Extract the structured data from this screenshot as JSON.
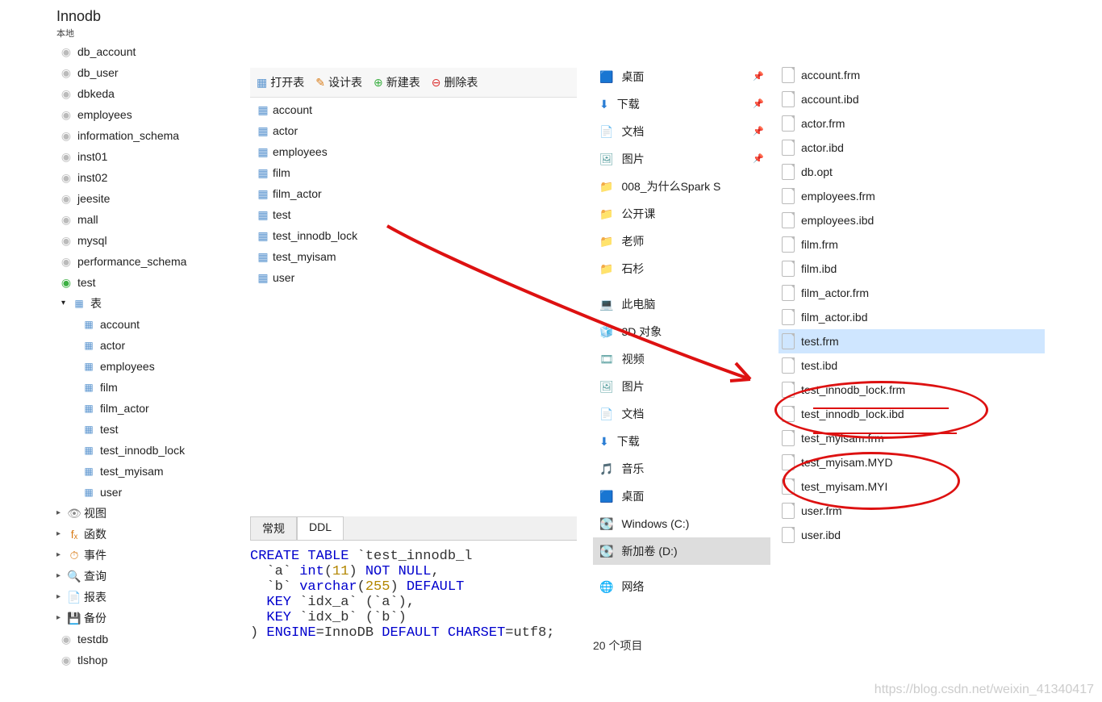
{
  "header": {
    "title": "Innodb",
    "sub": "本地"
  },
  "db_list": [
    {
      "name": "db_account",
      "ic": "db"
    },
    {
      "name": "db_user",
      "ic": "db"
    },
    {
      "name": "dbkeda",
      "ic": "db"
    },
    {
      "name": "employees",
      "ic": "db"
    },
    {
      "name": "information_schema",
      "ic": "db"
    },
    {
      "name": "inst01",
      "ic": "db"
    },
    {
      "name": "inst02",
      "ic": "db"
    },
    {
      "name": "jeesite",
      "ic": "db"
    },
    {
      "name": "mall",
      "ic": "db"
    },
    {
      "name": "mysql",
      "ic": "db"
    },
    {
      "name": "performance_schema",
      "ic": "db"
    },
    {
      "name": "test",
      "ic": "db",
      "active": true
    }
  ],
  "test_node": {
    "tables_label": "表"
  },
  "test_tables": [
    "account",
    "actor",
    "employees",
    "film",
    "film_actor",
    "test",
    "test_innodb_lock",
    "test_myisam",
    "user"
  ],
  "sub_items": [
    {
      "icon": "👁",
      "label": "视图"
    },
    {
      "icon": "fₓ",
      "label": "函数",
      "color": "#d97b16"
    },
    {
      "icon": "⏱",
      "label": "事件",
      "color": "#d97b16"
    },
    {
      "icon": "🔍",
      "label": "查询",
      "color": "#3b7fc4"
    },
    {
      "icon": "📄",
      "label": "报表",
      "color": "#888"
    },
    {
      "icon": "💾",
      "label": "备份",
      "color": "#555"
    }
  ],
  "trailing_dbs": [
    "testdb",
    "tlshop"
  ],
  "toolbar": {
    "open": "打开表",
    "design": "设计表",
    "new": "新建表",
    "delete": "删除表"
  },
  "mid_tables": [
    "account",
    "actor",
    "employees",
    "film",
    "film_actor",
    "test",
    "test_innodb_lock",
    "test_myisam",
    "user"
  ],
  "tabs": {
    "normal": "常规",
    "ddl": "DDL"
  },
  "ddl_lines": [
    {
      "t": "CREATE TABLE `test_innodb_l"
    },
    {
      "t": "  `a` int(11) NOT NULL,"
    },
    {
      "t": "  `b` varchar(255) DEFAULT"
    },
    {
      "t": "  KEY `idx_a` (`a`),"
    },
    {
      "t": "  KEY `idx_b` (`b`)"
    },
    {
      "t": ") ENGINE=InnoDB DEFAULT CHARSET=utf8;"
    }
  ],
  "explorer_nav": [
    {
      "icon": "🟦",
      "label": "桌面",
      "pin": true
    },
    {
      "icon": "⬇",
      "label": "下载",
      "pin": true,
      "color": "#2a7dd4"
    },
    {
      "icon": "📄",
      "label": "文档",
      "pin": true,
      "color": "#7aa0c4"
    },
    {
      "icon": "🖼",
      "label": "图片",
      "pin": true,
      "color": "#5aa0a0"
    },
    {
      "icon": "📁",
      "label": "008_为什么Spark S",
      "color": "#e8b93e"
    },
    {
      "icon": "📁",
      "label": "公开课",
      "color": "#e8b93e"
    },
    {
      "icon": "📁",
      "label": "老师",
      "color": "#e8b93e"
    },
    {
      "icon": "📁",
      "label": "石杉",
      "color": "#e8b93e"
    },
    {
      "spacer": true
    },
    {
      "icon": "💻",
      "label": "此电脑",
      "color": "#3b7fc4"
    },
    {
      "icon": "🧊",
      "label": "3D 对象",
      "color": "#3b7fc4"
    },
    {
      "icon": "🎞",
      "label": "视频",
      "color": "#5aa0a0"
    },
    {
      "icon": "🖼",
      "label": "图片",
      "color": "#5aa0a0"
    },
    {
      "icon": "📄",
      "label": "文档",
      "color": "#7aa0c4"
    },
    {
      "icon": "⬇",
      "label": "下载",
      "color": "#2a7dd4"
    },
    {
      "icon": "🎵",
      "label": "音乐",
      "color": "#2a7dd4"
    },
    {
      "icon": "🟦",
      "label": "桌面"
    },
    {
      "icon": "💽",
      "label": "Windows (C:)",
      "color": "#888"
    },
    {
      "icon": "💽",
      "label": "新加卷 (D:)",
      "color": "#888",
      "sel": true
    },
    {
      "spacer": true
    },
    {
      "icon": "🌐",
      "label": "网络",
      "color": "#3b7fc4"
    }
  ],
  "file_list": [
    "account.frm",
    "account.ibd",
    "actor.frm",
    "actor.ibd",
    "db.opt",
    "employees.frm",
    "employees.ibd",
    "film.frm",
    "film.ibd",
    "film_actor.frm",
    "film_actor.ibd",
    "test.frm",
    "test.ibd",
    "test_innodb_lock.frm",
    "test_innodb_lock.ibd",
    "test_myisam.frm",
    "test_myisam.MYD",
    "test_myisam.MYI",
    "user.frm",
    "user.ibd"
  ],
  "file_selected_index": 11,
  "footer_count": "20 个项目",
  "watermark": "https://blog.csdn.net/weixin_41340417"
}
